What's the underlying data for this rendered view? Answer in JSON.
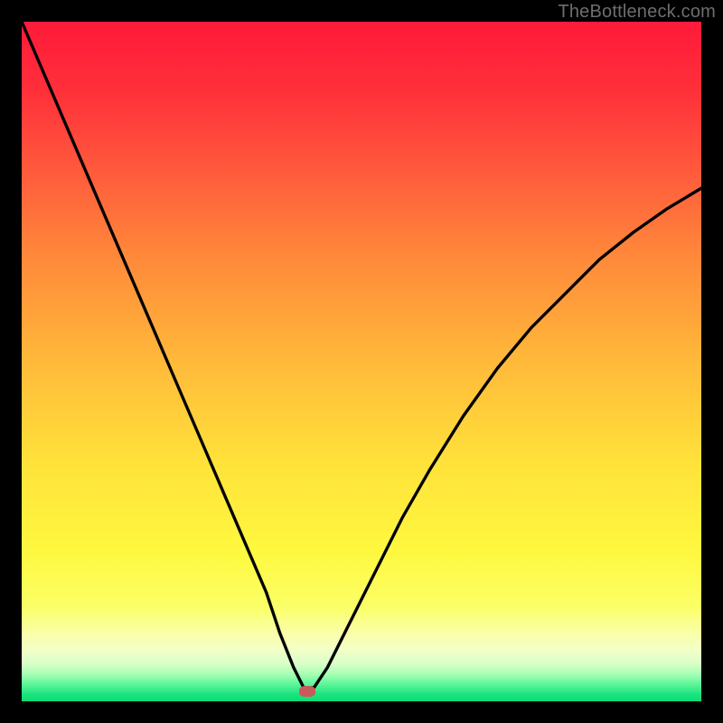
{
  "watermark": "TheBottleneck.com",
  "colors": {
    "frame": "#000000",
    "curve": "#000000",
    "marker": "#c85a5a",
    "gradient_stops": [
      {
        "offset": 0.0,
        "color": "#ff1a3a"
      },
      {
        "offset": 0.1,
        "color": "#ff2f3a"
      },
      {
        "offset": 0.22,
        "color": "#ff5a3c"
      },
      {
        "offset": 0.35,
        "color": "#ff8a3a"
      },
      {
        "offset": 0.5,
        "color": "#ffb93a"
      },
      {
        "offset": 0.65,
        "color": "#ffe23a"
      },
      {
        "offset": 0.78,
        "color": "#fff83f"
      },
      {
        "offset": 0.86,
        "color": "#fbff66"
      },
      {
        "offset": 0.9,
        "color": "#faffa9"
      },
      {
        "offset": 0.925,
        "color": "#f2ffc8"
      },
      {
        "offset": 0.945,
        "color": "#d8ffc8"
      },
      {
        "offset": 0.96,
        "color": "#a6ffb4"
      },
      {
        "offset": 0.975,
        "color": "#5cf598"
      },
      {
        "offset": 0.99,
        "color": "#1be37e"
      },
      {
        "offset": 1.0,
        "color": "#0bdc76"
      }
    ]
  },
  "chart_data": {
    "type": "line",
    "title": "",
    "xlabel": "",
    "ylabel": "",
    "xlim": [
      0,
      100
    ],
    "ylim": [
      0,
      100
    ],
    "grid": false,
    "legend": false,
    "series": [
      {
        "name": "bottleneck-curve",
        "x": [
          0,
          3,
          6,
          9,
          12,
          15,
          18,
          21,
          24,
          27,
          30,
          33,
          36,
          38,
          40,
          41.5,
          43,
          45,
          48,
          52,
          56,
          60,
          65,
          70,
          75,
          80,
          85,
          90,
          95,
          100
        ],
        "y": [
          100,
          93,
          86,
          79,
          72,
          65,
          58,
          51,
          44,
          37,
          30,
          23,
          16,
          10,
          5,
          2,
          2,
          5,
          11,
          19,
          27,
          34,
          42,
          49,
          55,
          60,
          65,
          69,
          72.5,
          75.5
        ]
      }
    ],
    "marker": {
      "x": 42,
      "y": 1.5
    },
    "background_gradient": "vertical red→orange→yellow→green (see colors.gradient_stops)"
  }
}
